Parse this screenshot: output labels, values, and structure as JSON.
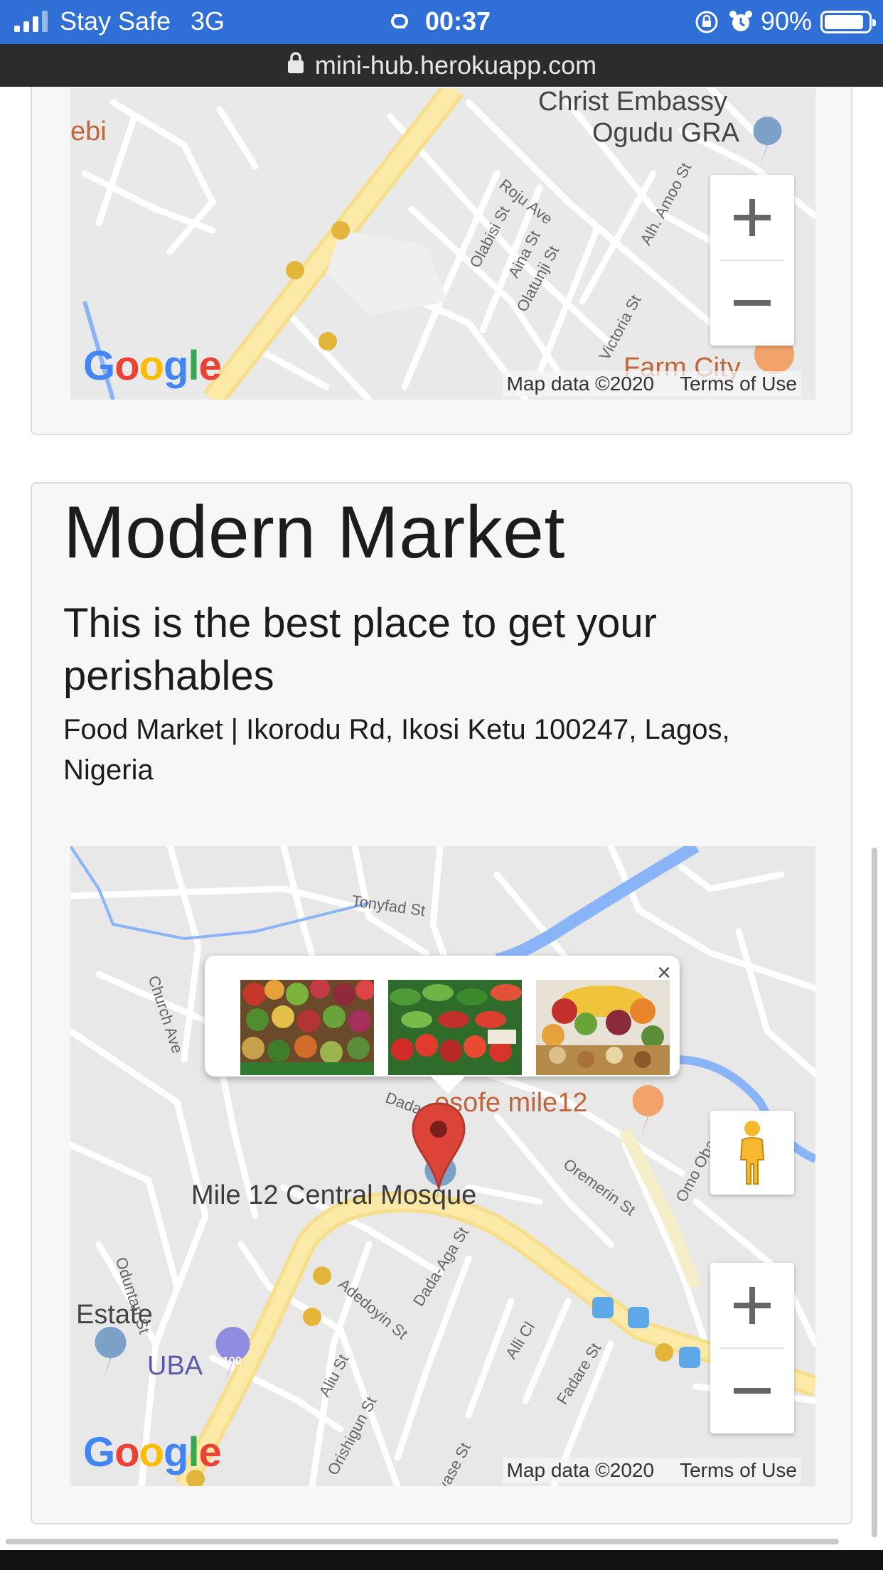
{
  "status_bar": {
    "carrier": "Stay Safe",
    "network": "3G",
    "time": "00:37",
    "battery": "90%",
    "battery_level": 0.9,
    "icons": [
      "signal-bars-icon",
      "hotspot-link-icon",
      "rotation-lock-icon",
      "alarm-icon",
      "battery-icon"
    ]
  },
  "browser": {
    "url": "mini-hub.herokuapp.com",
    "icon": "lock-icon"
  },
  "top_map": {
    "labels": [
      "Christ Embassy",
      "Ogudu GRA",
      "ebi",
      "Farm City"
    ],
    "streets": [
      "Roju Ave",
      "Olabisi St",
      "Aina St",
      "Olatunji St",
      "Alh. Amoo St",
      "Victoria St"
    ],
    "attribution": "Map data ©2020",
    "terms": "Terms of Use",
    "logo": "Google",
    "zoom_in": "+",
    "zoom_out": "−"
  },
  "listing": {
    "title": "Modern Market",
    "subtitle": "This is the best place to get your perishables",
    "meta": "Food Market | Ikorodu Rd, Ikosi Ketu 100247, Lagos, Nigeria"
  },
  "main_map": {
    "labels": {
      "mosque": "Mile 12 Central Mosque",
      "restaurant": "osofe mile12",
      "estate": "Estate",
      "bank": "UBA",
      "bank_badge": "100"
    },
    "streets": [
      "Tonyfad St",
      "Church Ave",
      "Oremerin St",
      "Omo Oban St",
      "Oduntan St",
      "Dada-Aga St",
      "Adedoyin St",
      "Aliu St",
      "Orishigun St",
      "Alli Cl",
      "Fadare St",
      "Iyase St",
      "Dada"
    ],
    "popup": {
      "close": "×",
      "images": [
        "vegetables-photo",
        "peppers-photo",
        "fruits-photo"
      ]
    },
    "attribution": "Map data ©2020",
    "terms": "Terms of Use",
    "logo": "Google",
    "zoom_in": "+",
    "zoom_out": "−"
  }
}
